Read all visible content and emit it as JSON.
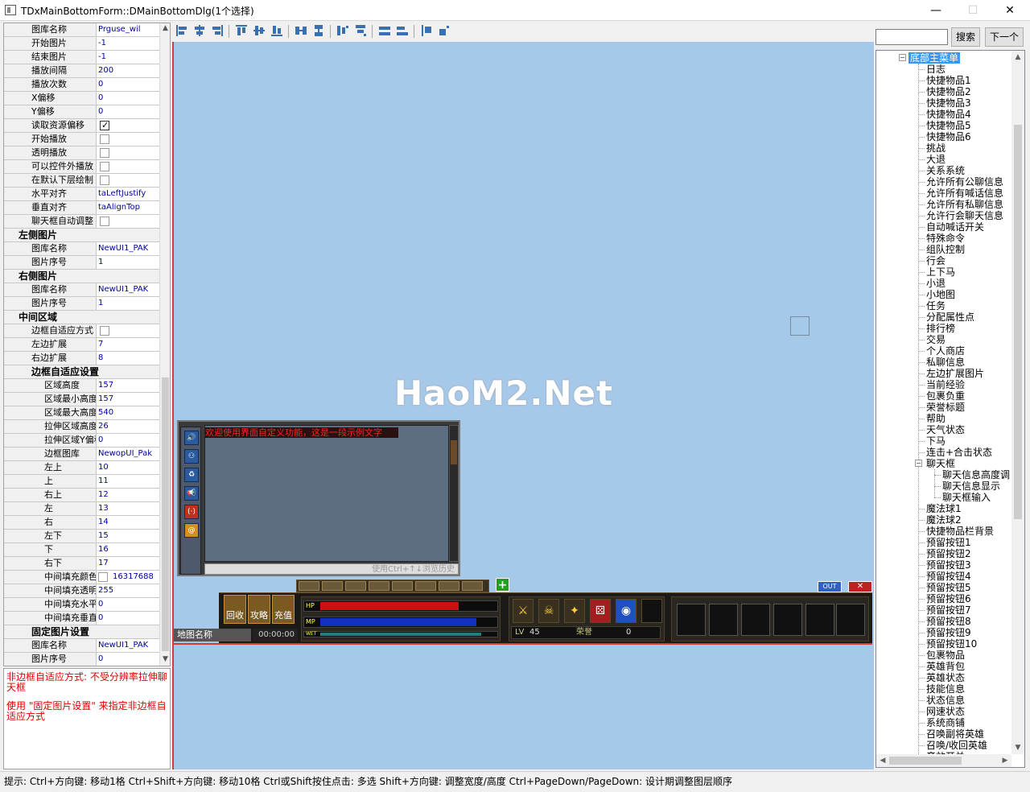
{
  "window": {
    "title": "TDxMainBottomForm::DMainBottomDlg(1个选择)",
    "minimize": "—",
    "maximize": "☐",
    "close": "✕"
  },
  "props": {
    "r0": {
      "name": "图库名称",
      "value": "Prguse_wil"
    },
    "r1": {
      "name": "开始图片",
      "value": "-1"
    },
    "r2": {
      "name": "结束图片",
      "value": "-1"
    },
    "r3": {
      "name": "播放间隔",
      "value": "200"
    },
    "r4": {
      "name": "播放次数",
      "value": "0"
    },
    "r5": {
      "name": "X偏移",
      "value": "0"
    },
    "r6": {
      "name": "Y偏移",
      "value": "0"
    },
    "r7": {
      "name": "读取资源偏移",
      "checked": true
    },
    "r8": {
      "name": "开始播放",
      "checked": false
    },
    "r9": {
      "name": "透明播放",
      "checked": false
    },
    "r10": {
      "name": "可以控件外播放",
      "checked": false
    },
    "r11": {
      "name": "在默认下层绘制",
      "checked": false
    },
    "r12": {
      "name": "水平对齐",
      "value": "taLeftJustify"
    },
    "r13": {
      "name": "垂直对齐",
      "value": "taAlignTop"
    },
    "r14": {
      "name": "聊天框自动调整",
      "checked": false
    },
    "cat_left": "左侧图片",
    "r15": {
      "name": "图库名称",
      "value": "NewUI1_PAK"
    },
    "r16": {
      "name": "图片序号",
      "value": "1"
    },
    "cat_right": "右侧图片",
    "r17": {
      "name": "图库名称",
      "value": "NewUI1_PAK"
    },
    "r18": {
      "name": "图片序号",
      "value": "1"
    },
    "cat_mid": "中间区域",
    "r19": {
      "name": "边框自适应方式",
      "checked": false
    },
    "r20": {
      "name": "左边扩展",
      "value": "7"
    },
    "r21": {
      "name": "右边扩展",
      "value": "8"
    },
    "cat_frame": "边框自适应设置",
    "r22": {
      "name": "区域高度",
      "value": "157"
    },
    "r23": {
      "name": "区域最小高度",
      "value": "157"
    },
    "r24": {
      "name": "区域最大高度",
      "value": "540"
    },
    "r25": {
      "name": "拉伸区域高度",
      "value": "26"
    },
    "r26": {
      "name": "拉伸区域Y偏移",
      "value": "0"
    },
    "r27": {
      "name": "边框图库",
      "value": "NewopUI_Pak"
    },
    "r28": {
      "name": "左上",
      "value": "10"
    },
    "r29": {
      "name": "上",
      "value": "11"
    },
    "r30": {
      "name": "右上",
      "value": "12"
    },
    "r31": {
      "name": "左",
      "value": "13"
    },
    "r32": {
      "name": "右",
      "value": "14"
    },
    "r33": {
      "name": "左下",
      "value": "15"
    },
    "r34": {
      "name": "下",
      "value": "16"
    },
    "r35": {
      "name": "右下",
      "value": "17"
    },
    "r36": {
      "name": "中间填充颜色",
      "value": "16317688"
    },
    "r37": {
      "name": "中间填充透明度",
      "value": "255"
    },
    "r38": {
      "name": "中间填充水平",
      "value": "0"
    },
    "r39": {
      "name": "中间填充垂直",
      "value": "0"
    },
    "cat_fixed": "固定图片设置",
    "r40": {
      "name": "图库名称",
      "value": "NewUI1_PAK"
    },
    "r41": {
      "name": "图片序号",
      "value": "0"
    }
  },
  "hints": {
    "line1": "非边框自适应方式: 不受分辨率拉伸聊天框",
    "line2": "使用 \"固定图片设置\" 来指定非边框自适应方式"
  },
  "canvas": {
    "watermark": "HaoM2.Net",
    "chat_notice": "欢迎使用界面自定义功能，这是一段示例文字",
    "chat_input_placeholder": "使用Ctrl+↑↓浏览历史",
    "chat_side_icons": [
      "🔊",
      "⚇",
      "♻",
      "📢",
      "(·)",
      "@"
    ],
    "icon_labels": [
      "回收",
      "攻略",
      "充值"
    ],
    "map_name": "地图名称",
    "time": "00:00:00",
    "hp_label": "HP",
    "mp_label": "MP",
    "exp_label": "WET",
    "level_label": "LV",
    "level_value": "45",
    "honor_label": "荣誉",
    "honor_value": "0",
    "out_label": "OUT",
    "x_label": "✕",
    "plus_label": "+",
    "skill_glyphs": [
      "⚔",
      "☠",
      "✦",
      "⚄",
      "◉"
    ],
    "hp_fill": 0.78,
    "mp_fill": 0.88,
    "hp_color": "#d01010",
    "mp_color": "#1030c0"
  },
  "search": {
    "search_label": "搜索",
    "next_label": "下一个"
  },
  "tree": {
    "root": "底部主菜单",
    "items": [
      "日志",
      "快捷物品1",
      "快捷物品2",
      "快捷物品3",
      "快捷物品4",
      "快捷物品5",
      "快捷物品6",
      "挑战",
      "大退",
      "关系系统",
      "允许所有公聊信息",
      "允许所有喊话信息",
      "允许所有私聊信息",
      "允许行会聊天信息",
      "自动喊话开关",
      "特殊命令",
      "组队控制",
      "行会",
      "上下马",
      "小退",
      "小地图",
      "任务",
      "分配属性点",
      "排行榜",
      "交易",
      "个人商店",
      "私聊信息",
      "左边扩展图片",
      "当前经验",
      "包裹负重",
      "荣誉标题",
      "帮助",
      "天气状态",
      "下马",
      "连击+合击状态"
    ],
    "chat_node": "聊天框",
    "chat_children": [
      "聊天信息高度调",
      "聊天信息显示",
      "聊天框输入"
    ],
    "items2": [
      "魔法球1",
      "魔法球2",
      "快捷物品栏背景",
      "预留按钮1",
      "预留按钮2",
      "预留按钮3",
      "预留按钮4",
      "预留按钮5",
      "预留按钮6",
      "预留按钮7",
      "预留按钮8",
      "预留按钮9",
      "预留按钮10",
      "包裹物品",
      "英雄背包",
      "英雄状态",
      "技能信息",
      "状态信息",
      "网速状态",
      "系统商铺",
      "召唤副将英雄",
      "召唤/收回英雄",
      "音效开关"
    ]
  },
  "status": {
    "text": "提示: Ctrl+方向键: 移动1格    Ctrl+Shift+方向键: 移动10格    Ctrl或Shift按住点击: 多选    Shift+方向键: 调整宽度/高度    Ctrl+PageDown/PageDown: 设计期调整图层顺序"
  },
  "colors": {
    "canvas_bg": "#a6c9ea",
    "accent_border": "#d04030",
    "tree_selection": "#3399ff",
    "hint_text": "#e00000"
  }
}
